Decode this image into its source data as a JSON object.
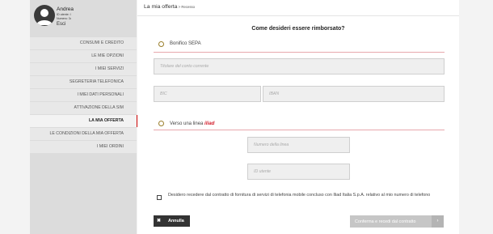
{
  "user": {
    "name": "Andrea",
    "id_line": "ID utente: I",
    "number_line": "Numero: 3•",
    "logout": "Esci"
  },
  "menu": [
    {
      "label": "CONSUMI E CREDITO"
    },
    {
      "label": "LE MIE OPZIONI"
    },
    {
      "label": "I MIEI SERVIZI"
    },
    {
      "label": "SEGRETERIA TELEFONICA"
    },
    {
      "label": "I MIEI DATI PERSONALI"
    },
    {
      "label": "ATTIVAZIONE DELLA SIM"
    },
    {
      "label": "LA MIA OFFERTA",
      "active": true
    },
    {
      "label": "LE CONDIZIONI DELLA MIA OFFERTA"
    },
    {
      "label": "I MIEI ORDINI"
    }
  ],
  "breadcrumb": {
    "title": "La mia offerta",
    "sub": " > Recesso"
  },
  "question": "Come desideri essere rimborsato?",
  "option_sepa": {
    "label": "Bonifico SEPA",
    "holder_placeholder": "Titolare del conto corrente",
    "bic_placeholder": "BIC",
    "iban_placeholder": "IBAN"
  },
  "option_line": {
    "label": "Verso una linea",
    "brand": "iliad",
    "number_placeholder": "Numero della linea",
    "userid_placeholder": "ID utente"
  },
  "consent": "Desidero recedere dal contratto di fornitura di servizi di telefonia mobile concluso con Iliad Italia S.p.A. relativo al mio numero di telefono",
  "buttons": {
    "cancel_icon": "✖",
    "cancel": "Annulla",
    "confirm": "Conferma e recedi dal contratto",
    "confirm_arrow": "›"
  }
}
